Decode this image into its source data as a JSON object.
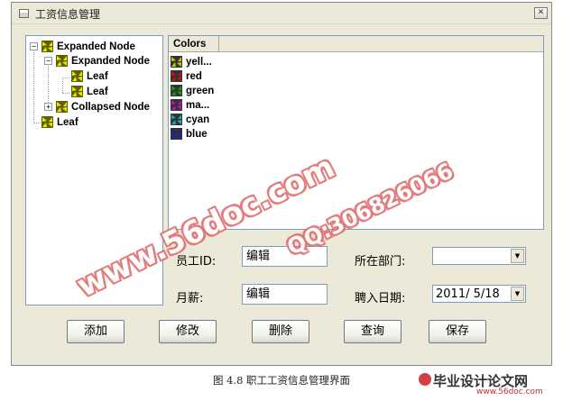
{
  "window": {
    "title": "工资信息管理",
    "close_glyph": "✕"
  },
  "tree": {
    "nodes": [
      {
        "label": "Expanded Node",
        "expander": "−"
      },
      {
        "label": "Expanded Node",
        "expander": "−"
      },
      {
        "label": "Leaf"
      },
      {
        "label": "Leaf"
      },
      {
        "label": "Collapsed Node",
        "expander": "+"
      },
      {
        "label": "Leaf"
      }
    ]
  },
  "list": {
    "header": "Colors",
    "items": [
      {
        "text": "yell...",
        "color": "#c8c800"
      },
      {
        "text": "red",
        "color": "#d01010"
      },
      {
        "text": "green",
        "color": "#10a010"
      },
      {
        "text": "ma...",
        "color": "#c010c0"
      },
      {
        "text": "cyan",
        "color": "#10b0b0"
      },
      {
        "text": "blue",
        "color": "#1020c0"
      }
    ]
  },
  "form": {
    "employee_id_label": "员工ID:",
    "employee_id_value": "编辑",
    "salary_label": "月薪:",
    "salary_value": "编辑",
    "department_label": "所在部门:",
    "department_value": "",
    "hire_date_label": "聘入日期:",
    "hire_date_value": "2011/ 5/18",
    "combo_arrow": "▼"
  },
  "buttons": {
    "add": "添加",
    "modify": "修改",
    "delete": "删除",
    "query": "查询",
    "save": "保存"
  },
  "watermark": {
    "site": "www.56doc.com",
    "qq": "QQ:306826066"
  },
  "caption": "图 4.8 职工工资信息管理界面",
  "logo": {
    "name": "毕业设计论文网",
    "url": "www.56doc.com"
  }
}
